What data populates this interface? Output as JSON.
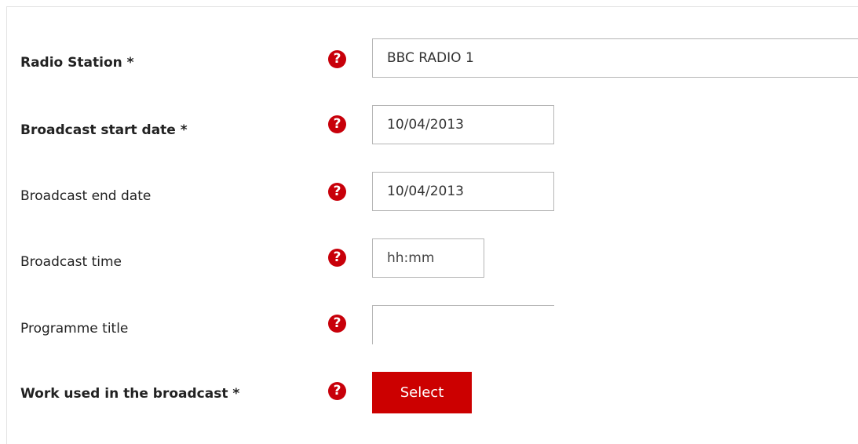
{
  "form": {
    "radio_station": {
      "label": "Radio Station *",
      "value": "BBC RADIO 1",
      "help": "?"
    },
    "start_date": {
      "label": "Broadcast start date *",
      "value": "10/04/2013",
      "help": "?"
    },
    "end_date": {
      "label": "Broadcast end date",
      "value": "10/04/2013",
      "help": "?"
    },
    "time": {
      "label": "Broadcast time",
      "value": "hh:mm",
      "help": "?"
    },
    "programme_title": {
      "label": "Programme title",
      "value": "",
      "help": "?"
    },
    "work_used": {
      "label": "Work used in the broadcast *",
      "help": "?",
      "button_label": "Select"
    }
  },
  "colors": {
    "accent": "#cc0000",
    "field_border": "#b5b5b5",
    "text": "#222222"
  },
  "icons": {
    "help": "question-mark-circle-icon"
  }
}
